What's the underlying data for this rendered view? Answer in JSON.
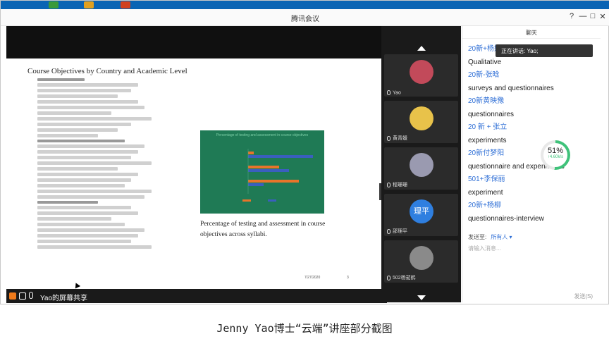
{
  "window": {
    "title": "腾讯会议",
    "controls": [
      "?",
      "—",
      "□",
      "✕"
    ]
  },
  "slide": {
    "title": "Course Objectives by Country and Academic Level",
    "chart_title": "Percentage of testing and assessment in course objectives",
    "caption": "Percentage of testing and assessment in course objectives across syllabi.",
    "date": "7/27/2020",
    "page": "3"
  },
  "share_bar": {
    "label": "Yao的屏幕共享"
  },
  "participants": [
    {
      "name": "Yao",
      "color": "#c24a5a"
    },
    {
      "name": "黄青媛",
      "color": "#e8c24a"
    },
    {
      "name": "程珊珊",
      "color": "#9a9ab0"
    },
    {
      "name": "邵理平",
      "initials": "理平",
      "color": "#2f7fe0"
    },
    {
      "name": "502杨茹鹤",
      "color": "#8a8a8a"
    }
  ],
  "chat": {
    "title": "聊天",
    "speaking": "正在讲话: Yao;",
    "messages": [
      {
        "sender": "20新+杨姆锺",
        "text": "Qualitative"
      },
      {
        "sender": "20新-张晗",
        "text": "surveys and questionnaires"
      },
      {
        "sender": "20新黄映豫",
        "text": "questionnaires"
      },
      {
        "sender": "20 新 + 张立",
        "text": "experiments"
      },
      {
        "sender": "20新付梦阳",
        "text": "questionnaire and experiments"
      },
      {
        "sender": "501+李保丽",
        "text": "experiment"
      },
      {
        "sender": "20新+杨柳",
        "text": "questionnaires-interview"
      }
    ],
    "send_to_label": "发送至:",
    "send_to_value": "所有人 ▾",
    "input_placeholder": "请输入消息...",
    "send_button": "发送(S)"
  },
  "gauge": {
    "value": "51%",
    "sub": "↑4.60k/s",
    "percent": 51
  },
  "figure_caption": "Jenny Yao博士“云端”讲座部分截图"
}
